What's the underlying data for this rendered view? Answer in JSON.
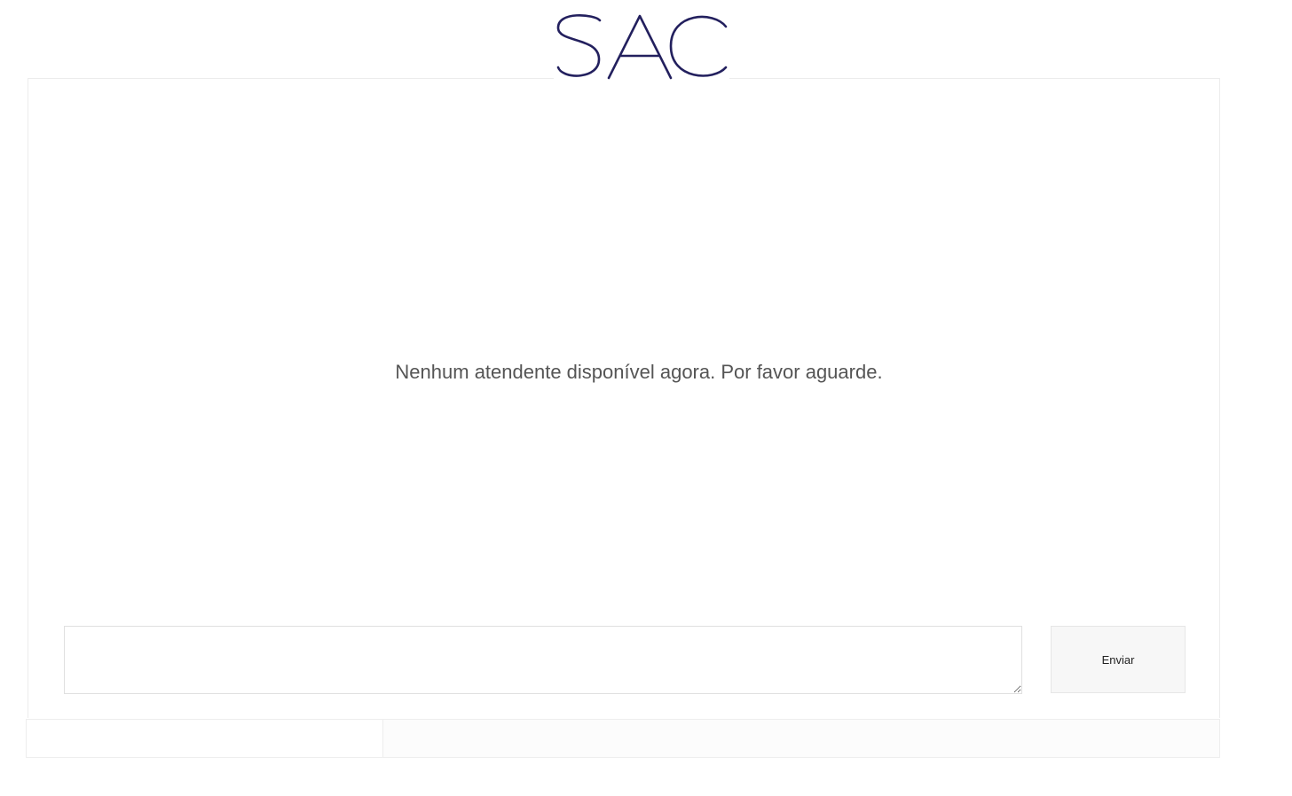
{
  "header": {
    "logo_text": "SAC",
    "logo_color": "#23205e"
  },
  "chat": {
    "status_message": "Nenhum atendente disponível agora. Por favor aguarde."
  },
  "composer": {
    "message_value": "",
    "send_label": "Enviar"
  }
}
